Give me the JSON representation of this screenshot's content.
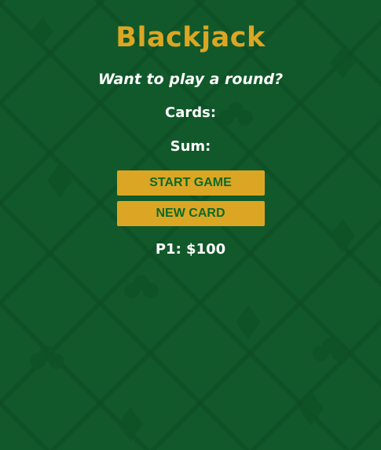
{
  "game": {
    "title": "Blackjack",
    "message": "Want to play a round?",
    "cards_label": "Cards:",
    "sum_label": "Sum:",
    "start_button_label": "START GAME",
    "new_card_button_label": "NEW CARD",
    "player_info": "P1: $100"
  },
  "colors": {
    "felt_background": "#11592a",
    "accent_gold": "#dba624",
    "button_text_green": "#0d6a25",
    "text_white": "#ffffff"
  },
  "background": {
    "pattern_icons": [
      "spade-icon",
      "heart-icon",
      "diamond-icon",
      "club-icon"
    ]
  }
}
